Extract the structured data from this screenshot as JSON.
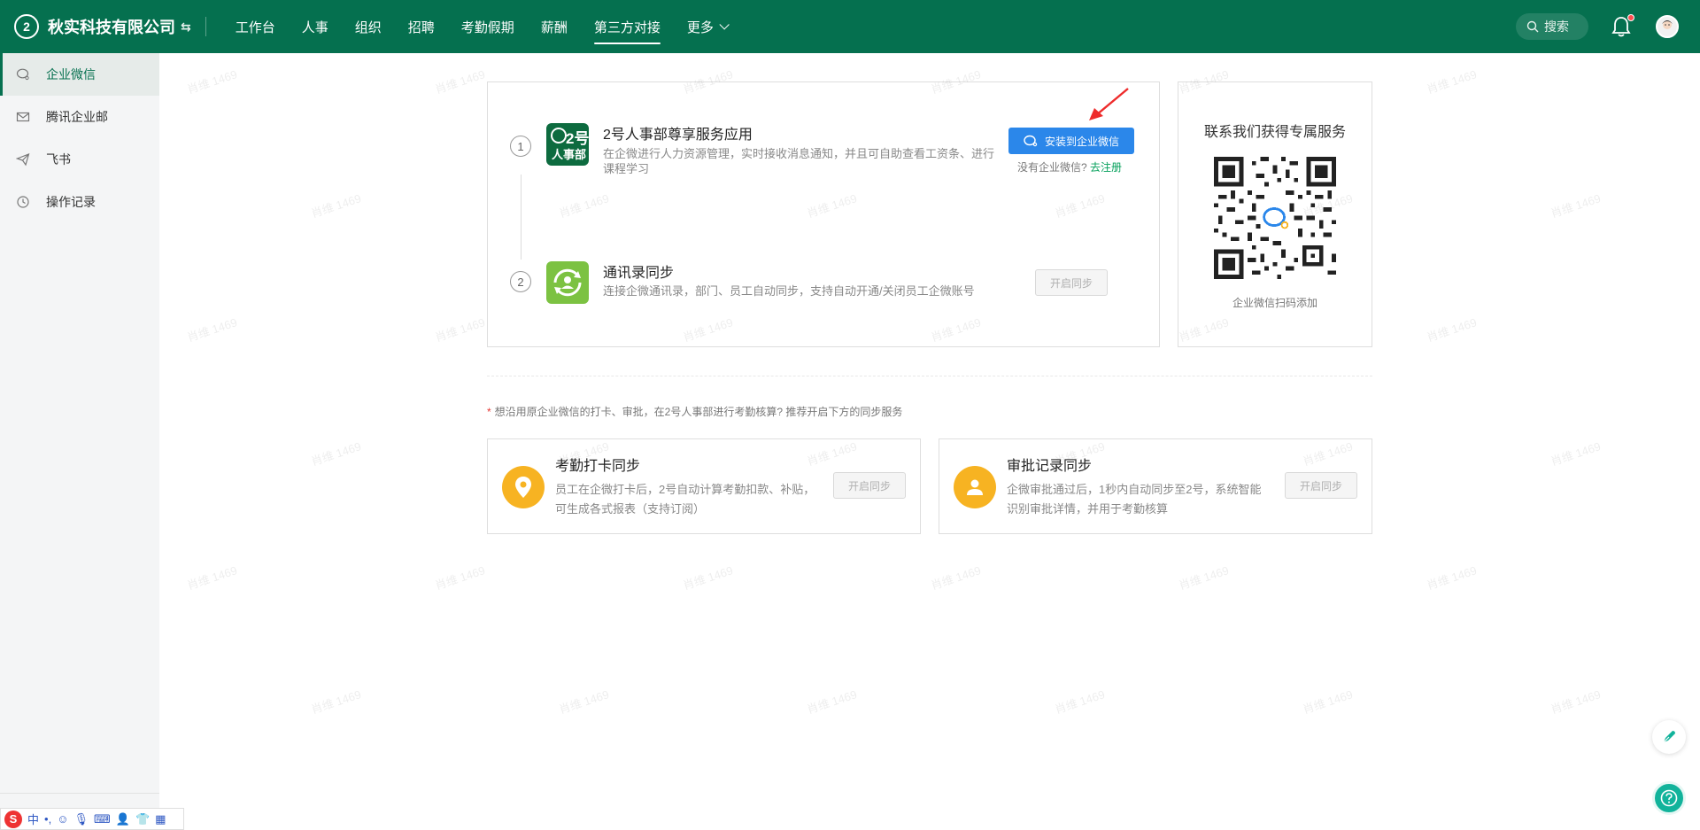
{
  "header": {
    "logo_text": "2",
    "company": "秋实科技有限公司",
    "nav": [
      {
        "label": "工作台"
      },
      {
        "label": "人事"
      },
      {
        "label": "组织"
      },
      {
        "label": "招聘"
      },
      {
        "label": "考勤假期"
      },
      {
        "label": "薪酬"
      },
      {
        "label": "第三方对接",
        "active": true
      },
      {
        "label": "更多"
      }
    ],
    "search_label": "搜索"
  },
  "sidebar": {
    "items": [
      {
        "label": "企业微信",
        "icon": "chat-bubble-icon",
        "active": true
      },
      {
        "label": "腾讯企业邮",
        "icon": "mail-icon"
      },
      {
        "label": "飞书",
        "icon": "paper-plane-icon"
      },
      {
        "label": "操作记录",
        "icon": "clock-icon"
      }
    ]
  },
  "main": {
    "step1": {
      "num": "1",
      "icon_text": "2号\n人事部",
      "title": "2号人事部尊享服务应用",
      "desc": "在企微进行人力资源管理，实时接收消息通知，并且可自助查看工资条、进行课程学习",
      "install_button": "安装到企业微信",
      "no_account": "没有企业微信?",
      "register_link": "去注册"
    },
    "step2": {
      "num": "2",
      "title": "通讯录同步",
      "desc": "连接企微通讯录，部门、员工自动同步，支持自动开通/关闭员工企微账号",
      "button": "开启同步"
    },
    "qr": {
      "title": "联系我们获得专属服务",
      "caption": "企业微信扫码添加"
    },
    "tip": {
      "star": "*",
      "text": "想沿用原企业微信的打卡、审批，在2号人事部进行考勤核算? 推荐开启下方的同步服务"
    },
    "sync_cards": [
      {
        "title": "考勤打卡同步",
        "desc": "员工在企微打卡后，2号自动计算考勤扣款、补贴，可生成各式报表（支持订阅）",
        "button": "开启同步",
        "icon": "location-pin-icon"
      },
      {
        "title": "审批记录同步",
        "desc": "企微审批通过后，1秒内自动同步至2号，系统智能识别审批详情，并用于考勤核算",
        "button": "开启同步",
        "icon": "user-icon"
      }
    ]
  },
  "watermark": "肖维 1469",
  "colors": {
    "brand": "#05704f",
    "primary_button": "#2b87ea",
    "link": "#05a05b",
    "sync_icon": "#f7b322",
    "help_button": "#12b39b"
  },
  "ime": {
    "logo": "S",
    "mode": "中"
  }
}
